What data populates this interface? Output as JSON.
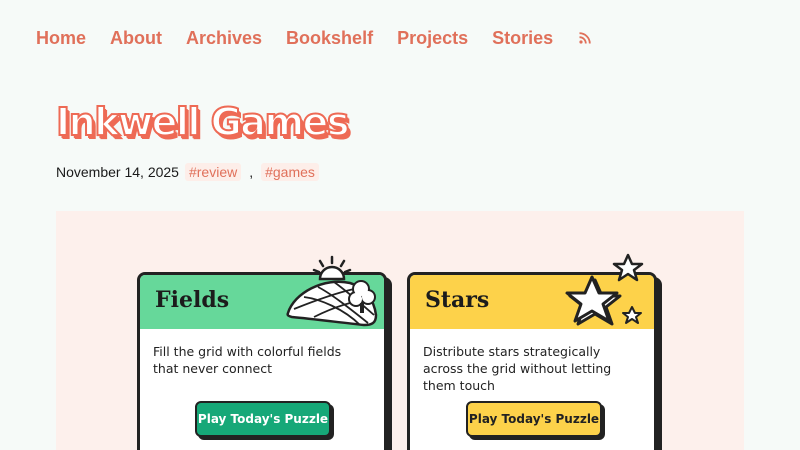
{
  "nav": {
    "items": [
      "Home",
      "About",
      "Archives",
      "Bookshelf",
      "Projects",
      "Stories"
    ],
    "rss_icon": "rss-icon"
  },
  "post": {
    "title": "Inkwell Games",
    "date": "November 14, 2025",
    "tags": [
      "#review",
      "#games"
    ],
    "separator": ","
  },
  "cards": [
    {
      "title": "Fields",
      "description": "Fill the grid with colorful fields that never connect",
      "button": "Play Today's Puzzle",
      "color": "#66d89a",
      "button_color": "#16a878",
      "icon": "hill-field-icon"
    },
    {
      "title": "Stars",
      "description": "Distribute stars strategically across the grid without letting them touch",
      "button": "Play Today's Puzzle",
      "color": "#fdd24a",
      "button_color": "#fdd24a",
      "icon": "stars-icon"
    }
  ],
  "colors": {
    "accent": "#e0705a",
    "background": "#f6faf8",
    "hero_background": "#fdf0ec"
  }
}
